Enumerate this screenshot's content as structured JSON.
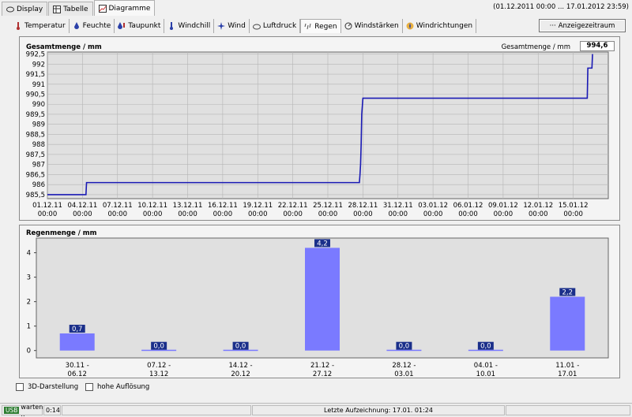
{
  "top_tabs": [
    {
      "label": "Display",
      "icon": "display-icon"
    },
    {
      "label": "Tabelle",
      "icon": "table-icon"
    },
    {
      "label": "Diagramme",
      "icon": "chart-icon",
      "active": true
    }
  ],
  "date_range": "(01.12.2011 00:00 ... 17.01.2012 23:59)",
  "chart_tabs": [
    {
      "label": "Temperatur",
      "icon": "thermometer-icon",
      "color": "#b03030"
    },
    {
      "label": "Feuchte",
      "icon": "humidity-icon",
      "color": "#2a3fa8"
    },
    {
      "label": "Taupunkt",
      "icon": "dewpoint-icon",
      "color": "#2a3fa8"
    },
    {
      "label": "Windchill",
      "icon": "windchill-icon",
      "color": "#2a3fa8"
    },
    {
      "label": "Wind",
      "icon": "wind-icon",
      "color": "#2a3fa8"
    },
    {
      "label": "Luftdruck",
      "icon": "cloud-icon",
      "color": "#444"
    },
    {
      "label": "Regen",
      "icon": "rain-icon",
      "color": "#555",
      "active": true
    },
    {
      "label": "Windstärken",
      "icon": "windstrength-icon",
      "color": "#333"
    },
    {
      "label": "Windrichtungen",
      "icon": "compass-icon",
      "color": "#c08020"
    }
  ],
  "anzeige_label": "Anzeigezeitraum",
  "anzeige_prefix": "···",
  "panel1": {
    "title": "Gesamtmenge / mm",
    "total_label": "Gesamtmenge / mm",
    "total_value": "994,6"
  },
  "panel2": {
    "title": "Regenmenge / mm"
  },
  "options": {
    "3d_label": "3D-Darstellung",
    "hires_label": "hohe Auflösung"
  },
  "status": {
    "usb": "USB",
    "state": "warten ..",
    "time": "0:14",
    "last_record": "Letzte Aufzeichnung: 17.01. 01:24"
  },
  "chart_data": [
    {
      "type": "line",
      "title": "Gesamtmenge / mm",
      "ylim": [
        985.3,
        992.6
      ],
      "y_ticks": [
        "992,5",
        "992",
        "991,5",
        "991",
        "990,5",
        "990",
        "989,5",
        "989",
        "988,5",
        "988",
        "987,5",
        "987",
        "986,5",
        "986",
        "985,5"
      ],
      "y_tick_values": [
        992.5,
        992,
        991.5,
        991,
        990.5,
        990,
        989.5,
        989,
        988.5,
        988,
        987.5,
        987,
        986.5,
        986,
        985.5
      ],
      "x_ticks": [
        [
          "01.12.11",
          "00:00"
        ],
        [
          "04.12.11",
          "00:00"
        ],
        [
          "07.12.11",
          "00:00"
        ],
        [
          "10.12.11",
          "00:00"
        ],
        [
          "13.12.11",
          "00:00"
        ],
        [
          "16.12.11",
          "00:00"
        ],
        [
          "19.12.11",
          "00:00"
        ],
        [
          "22.12.11",
          "00:00"
        ],
        [
          "25.12.11",
          "00:00"
        ],
        [
          "28.12.11",
          "00:00"
        ],
        [
          "31.12.11",
          "00:00"
        ],
        [
          "03.01.12",
          "00:00"
        ],
        [
          "06.01.12",
          "00:00"
        ],
        [
          "09.01.12",
          "00:00"
        ],
        [
          "12.01.12",
          "00:00"
        ],
        [
          "15.01.12",
          "00:00"
        ]
      ],
      "x_range_days": [
        0,
        48
      ],
      "x_day_unit_note": "x in days from 01.12.11 00:00",
      "series_color": "#1a1ab4",
      "points": [
        [
          0,
          985.5
        ],
        [
          3.3,
          985.5
        ],
        [
          3.35,
          986.1
        ],
        [
          26.7,
          986.1
        ],
        [
          26.75,
          986.5
        ],
        [
          26.8,
          987
        ],
        [
          26.85,
          988
        ],
        [
          26.9,
          989.5
        ],
        [
          27.0,
          990.3
        ],
        [
          46.2,
          990.3
        ],
        [
          46.25,
          991.8
        ],
        [
          46.6,
          991.8
        ],
        [
          46.65,
          992.5
        ]
      ]
    },
    {
      "type": "bar",
      "title": "Regenmenge / mm",
      "categories": [
        "30.11 - 06.12",
        "07.12 - 13.12",
        "14.12 - 20.12",
        "21.12 - 27.12",
        "28.12 - 03.01",
        "04.01 - 10.01",
        "11.01 - 17.01"
      ],
      "values": [
        0.7,
        0.0,
        0.0,
        4.2,
        0.0,
        0.0,
        2.2
      ],
      "value_labels": [
        "0,7",
        "0,0",
        "0,0",
        "4,2",
        "0,0",
        "0,0",
        "2,2"
      ],
      "ylim": [
        -0.3,
        4.6
      ],
      "y_ticks": [
        0,
        1,
        2,
        3,
        4
      ],
      "bar_color": "#7a7aff",
      "label_bg": "#1a2f8a"
    }
  ]
}
